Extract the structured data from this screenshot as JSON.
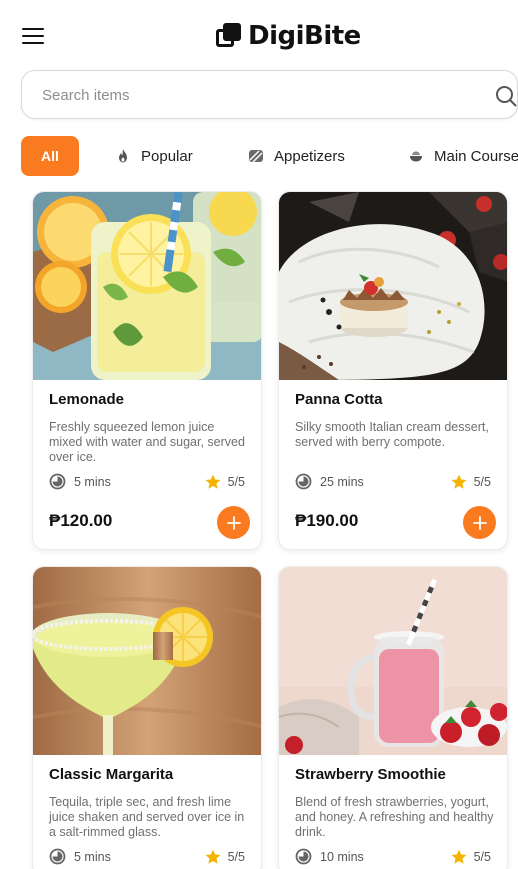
{
  "header": {
    "logo_text": "DigiBite",
    "menu_icon": "hamburger-menu-icon"
  },
  "search": {
    "placeholder": "Search items",
    "icon": "search-icon"
  },
  "categories": [
    {
      "label": "All",
      "icon": "",
      "active": true
    },
    {
      "label": "Popular",
      "icon": "fire-icon",
      "active": false
    },
    {
      "label": "Appetizers",
      "icon": "stripes-icon",
      "active": false
    },
    {
      "label": "Main Course",
      "icon": "bowl-icon",
      "active": false
    }
  ],
  "products": [
    {
      "name": "Lemonade",
      "description": "Freshly squeezed lemon juice mixed with water and sugar, served over ice.",
      "time": "5 mins",
      "rating": "5/5",
      "price": "₱120.00"
    },
    {
      "name": "Panna Cotta",
      "description": "Silky smooth Italian cream dessert, served with berry compote.",
      "time": "25 mins",
      "rating": "5/5",
      "price": "₱190.00"
    },
    {
      "name": "Classic Margarita",
      "description": "Tequila, triple sec, and fresh lime juice shaken and served over ice in a salt-rimmed glass.",
      "time": "5 mins",
      "rating": "5/5",
      "price": ""
    },
    {
      "name": "Strawberry Smoothie",
      "description": "Blend of fresh strawberries, yogurt, and honey. A refreshing and healthy drink.",
      "time": "10 mins",
      "rating": "5/5",
      "price": ""
    }
  ],
  "colors": {
    "accent": "#f97a1f",
    "star": "#f5b301",
    "text_muted": "#707070"
  }
}
